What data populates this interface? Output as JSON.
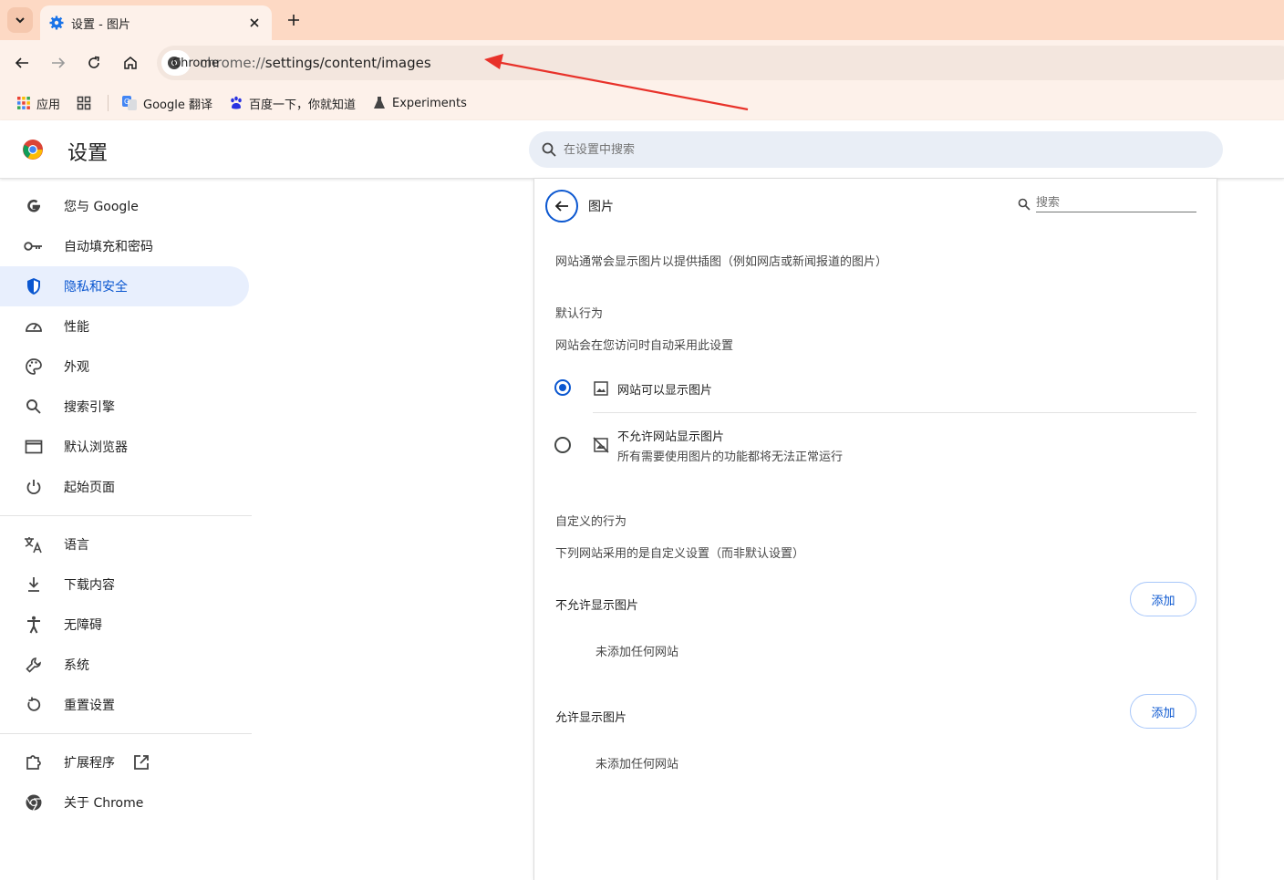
{
  "tab": {
    "title": "设置 - 图片"
  },
  "omnibox": {
    "chip_label": "Chrome",
    "url_scheme": "chrome://",
    "url_rest": "settings/content/images"
  },
  "bookmarks": [
    {
      "label": "应用",
      "icon": "apps-grid-icon"
    },
    {
      "label": "Google 翻译",
      "icon": "google-translate-icon"
    },
    {
      "label": "百度一下，你就知道",
      "icon": "baidu-paw-icon"
    },
    {
      "label": "Experiments",
      "icon": "flask-icon"
    }
  ],
  "header": {
    "title": "设置",
    "search_placeholder": "在设置中搜索"
  },
  "sidebar": {
    "items": [
      {
        "label": "您与 Google",
        "icon": "google-g-icon"
      },
      {
        "label": "自动填充和密码",
        "icon": "key-icon"
      },
      {
        "label": "隐私和安全",
        "icon": "shield-icon",
        "active": true
      },
      {
        "label": "性能",
        "icon": "speedometer-icon"
      },
      {
        "label": "外观",
        "icon": "palette-icon"
      },
      {
        "label": "搜索引擎",
        "icon": "search-icon"
      },
      {
        "label": "默认浏览器",
        "icon": "browser-window-icon"
      },
      {
        "label": "起始页面",
        "icon": "power-icon"
      },
      {
        "label": "语言",
        "icon": "translate-icon"
      },
      {
        "label": "下载内容",
        "icon": "download-icon"
      },
      {
        "label": "无障碍",
        "icon": "accessibility-icon"
      },
      {
        "label": "系统",
        "icon": "wrench-icon"
      },
      {
        "label": "重置设置",
        "icon": "reset-icon"
      },
      {
        "label": "扩展程序",
        "icon": "puzzle-icon"
      },
      {
        "label": "关于 Chrome",
        "icon": "chrome-icon"
      }
    ]
  },
  "page": {
    "title": "图片",
    "search_placeholder": "搜索",
    "description": "网站通常会显示图片以提供插图（例如网店或新闻报道的图片）",
    "default_behavior_heading": "默认行为",
    "default_behavior_sub": "网站会在您访问时自动采用此设置",
    "option_allow": "网站可以显示图片",
    "option_block": "不允许网站显示图片",
    "option_block_sub": "所有需要使用图片的功能都将无法正常运行",
    "custom_heading": "自定义的行为",
    "custom_sub": "下列网站采用的是自定义设置（而非默认设置）",
    "block_list_heading": "不允许显示图片",
    "allow_list_heading": "允许显示图片",
    "add_label": "添加",
    "empty_label": "未添加任何网站"
  },
  "colors": {
    "accent": "#0b57d0",
    "tabstrip": "#fdd9c4",
    "toolbar": "#fdf1ea",
    "active_nav": "#e8effd",
    "annotation_arrow": "#e8322a"
  }
}
